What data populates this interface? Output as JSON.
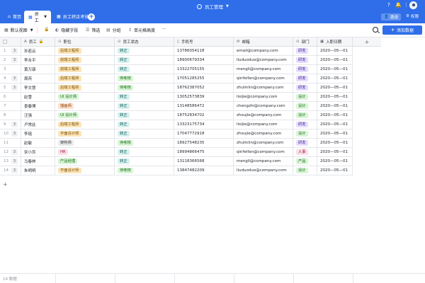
{
  "header": {
    "app_title": "员工管理",
    "tabs": [
      {
        "label": "首页",
        "icon": "home-icon"
      },
      {
        "label": "员工",
        "icon": "table-icon"
      },
      {
        "label": "员工转正考核",
        "icon": "table-icon"
      }
    ],
    "share_label": "邀请",
    "permission_label": "权限",
    "icons": [
      "help-icon",
      "bell-icon",
      "more-icon",
      "avatar"
    ]
  },
  "toolbar": {
    "view_label": "默认视图",
    "hide_fields_label": "隐藏字段",
    "filter_label": "筛选",
    "group_label": "分组",
    "row_height_label": "单元格高度",
    "more_label": "···",
    "add_record_label": "添加数据"
  },
  "columns": [
    {
      "label": "员工",
      "icon": "text-icon"
    },
    {
      "label": "职位",
      "icon": "select-icon"
    },
    {
      "label": "员工状态",
      "icon": "select-icon"
    },
    {
      "label": "手机号",
      "icon": "phone-icon"
    },
    {
      "label": "邮箱",
      "icon": "email-icon"
    },
    {
      "label": "部门",
      "icon": "select-icon"
    },
    {
      "label": "入职日期",
      "icon": "calendar-icon"
    }
  ],
  "rows": [
    {
      "idx": "1",
      "comments": "3",
      "name": "孙若云",
      "position": "后端工程师",
      "pos_color": "yellow",
      "status": "转正",
      "status_color": "teal",
      "phone": "13786054118",
      "email": "email@company.com",
      "dept": "研发",
      "dept_color": "purple",
      "date": "2020—05—01"
    },
    {
      "idx": "2",
      "comments": "3",
      "name": "李永平",
      "position": "前端工程师",
      "pos_color": "yellow",
      "status": "转正",
      "status_color": "teal",
      "phone": "18900679334",
      "email": "liuduoduo@company.com",
      "dept": "研发",
      "dept_color": "purple",
      "date": "2020—05—01"
    },
    {
      "idx": "3",
      "comments": "",
      "name": "黄万康",
      "position": "前端工程师",
      "pos_color": "yellow",
      "status": "转正",
      "status_color": "teal",
      "phone": "13322705155",
      "email": "mengli@company.com",
      "dept": "研发",
      "dept_color": "purple",
      "date": "2020—05—01"
    },
    {
      "idx": "4",
      "comments": "3",
      "name": "周芮",
      "position": "后端工程师",
      "pos_color": "yellow",
      "status": "待考核",
      "status_color": "green",
      "phone": "17051285255",
      "email": "qinfeifan@company.com",
      "dept": "研发",
      "dept_color": "purple",
      "date": "2020—05—01"
    },
    {
      "idx": "5",
      "comments": "3",
      "name": "李文慧",
      "position": "后端工程师",
      "pos_color": "yellow",
      "status": "待考核",
      "status_color": "green",
      "phone": "18762387052",
      "email": "zhulinlin@company.com",
      "dept": "研发",
      "dept_color": "purple",
      "date": "2020—05—01"
    },
    {
      "idx": "6",
      "comments": "",
      "name": "赵雪",
      "position": "UI 设计师",
      "pos_color": "green",
      "status": "转正",
      "status_color": "teal",
      "phone": "13052573839",
      "email": "lisijie@company.com",
      "dept": "设计",
      "dept_color": "green",
      "date": "2020—05—01"
    },
    {
      "idx": "7",
      "comments": "",
      "name": "景春博",
      "position": "插画师",
      "pos_color": "orange",
      "status": "转正",
      "status_color": "teal",
      "phone": "13148586472",
      "email": "chengzhi@company.com",
      "dept": "设计",
      "dept_color": "green",
      "date": "2020—05—01"
    },
    {
      "idx": "8",
      "comments": "",
      "name": "汪强",
      "position": "UI 设计师",
      "pos_color": "green",
      "status": "转正",
      "status_color": "teal",
      "phone": "18752834702",
      "email": "zhoujie@company.com",
      "dept": "设计",
      "dept_color": "green",
      "date": "2020—05—01"
    },
    {
      "idx": "9",
      "comments": "3",
      "name": "卢常此",
      "position": "后端工程师",
      "pos_color": "yellow",
      "status": "转正",
      "status_color": "teal",
      "phone": "13323175734",
      "email": "lisijie@company.com",
      "dept": "研发",
      "dept_color": "purple",
      "date": "2020—05—01"
    },
    {
      "idx": "10",
      "comments": "3",
      "name": "李瑶",
      "position": "平面设计师",
      "pos_color": "yellow",
      "status": "转正",
      "status_color": "teal",
      "phone": "17047772918",
      "email": "zhoujie@company.com",
      "dept": "设计",
      "dept_color": "green",
      "date": "2020—05—01"
    },
    {
      "idx": "11",
      "comments": "",
      "name": "赵敏",
      "position": "架构师",
      "pos_color": "gray",
      "status": "待考核",
      "status_color": "green",
      "phone": "18927548235",
      "email": "zhulinlin@company.com",
      "dept": "研发",
      "dept_color": "purple",
      "date": "2020—05—01"
    },
    {
      "idx": "12",
      "comments": "3",
      "name": "宋小芳",
      "position": "HR",
      "pos_color": "pink",
      "status": "转正",
      "status_color": "teal",
      "phone": "18994866475",
      "email": "qinfeifan@company.com",
      "dept": "人事",
      "dept_color": "pink",
      "date": "2020—05—01"
    },
    {
      "idx": "13",
      "comments": "3",
      "name": "马春林",
      "position": "产品经理",
      "pos_color": "green",
      "status": "转正",
      "status_color": "teal",
      "phone": "13118366568",
      "email": "mengli@company.com",
      "dept": "产品",
      "dept_color": "green",
      "date": "2020—05—01"
    },
    {
      "idx": "14",
      "comments": "3",
      "name": "朱明明",
      "position": "平面设计师",
      "pos_color": "yellow",
      "status": "待考核",
      "status_color": "green",
      "phone": "13847482209",
      "email": "liuduoduo@company.com",
      "dept": "设计",
      "dept_color": "green",
      "date": "2020—05—01"
    }
  ],
  "footer": {
    "record_count": "14 数据"
  },
  "colors": {
    "brand": "#2f6ee8",
    "header_bg": "#f5f6f7",
    "border": "#e5e6eb"
  }
}
